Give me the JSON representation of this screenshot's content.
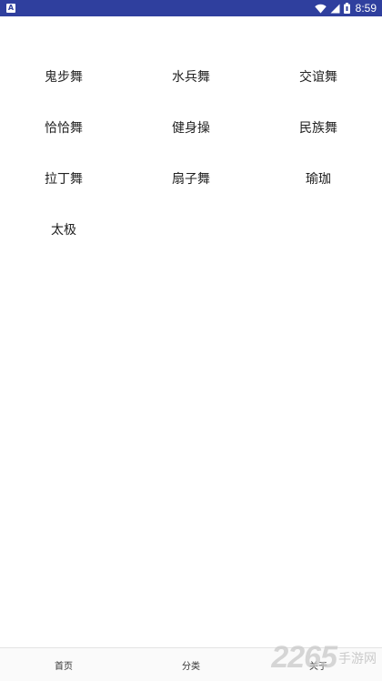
{
  "status_bar": {
    "time": "8:59",
    "icons": [
      "app-notification-icon",
      "wifi-icon",
      "signal-icon",
      "battery-icon"
    ]
  },
  "categories": [
    {
      "label": "鬼步舞"
    },
    {
      "label": "水兵舞"
    },
    {
      "label": "交谊舞"
    },
    {
      "label": "恰恰舞"
    },
    {
      "label": "健身操"
    },
    {
      "label": "民族舞"
    },
    {
      "label": "拉丁舞"
    },
    {
      "label": "扇子舞"
    },
    {
      "label": "瑜珈"
    },
    {
      "label": "太极"
    }
  ],
  "bottom_nav": {
    "tabs": [
      {
        "label": "首页"
      },
      {
        "label": "分类"
      },
      {
        "label": "关于"
      }
    ]
  },
  "watermark": {
    "digits": "2265",
    "text": "手游网"
  },
  "colors": {
    "status_bar": "#2f3f9e",
    "background": "#ffffff",
    "text": "#222222"
  }
}
